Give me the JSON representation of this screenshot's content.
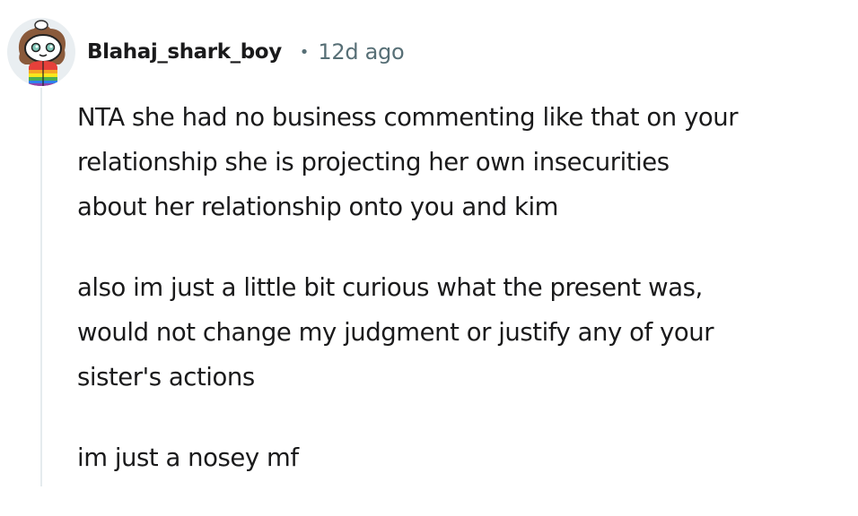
{
  "comment": {
    "author": "Blahaj_shark_boy",
    "separator": "•",
    "timestamp": "12d ago",
    "paragraphs": [
      {
        "lines": [
          "NTA she had no business commenting like that on your",
          "relationship she is projecting her own insecurities",
          "about her relationship onto you and kim"
        ]
      },
      {
        "lines": [
          "also im just a little bit curious what the present was,",
          "would not change my judgment or justify any of your",
          "sister's actions"
        ]
      },
      {
        "lines": [
          "im just a nosey mf"
        ]
      }
    ]
  },
  "icons": {
    "avatar": "snoo-avatar-icon"
  },
  "colors": {
    "text": "#1a1a1b",
    "meta": "#576f76",
    "thread_line": "#e5ebee",
    "avatar_bg": "#e9eef1"
  }
}
